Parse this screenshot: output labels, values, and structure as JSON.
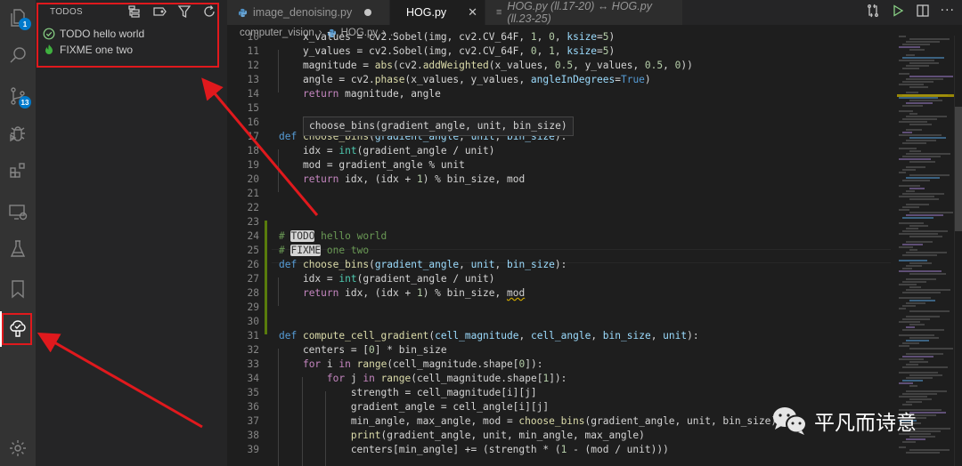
{
  "activity_bar": {
    "explorer_badge": "1",
    "source_control_badge": "13",
    "items": [
      "explorer",
      "search",
      "source-control",
      "run-debug",
      "extensions",
      "remote-explorer",
      "testing",
      "bookmarks",
      "todo-tree",
      "settings"
    ]
  },
  "sidebar": {
    "title": "TODOS",
    "actions": [
      "tree-view",
      "tag",
      "filter",
      "refresh"
    ],
    "items": [
      {
        "label": "TODO hello world",
        "icon": "check-circle-icon",
        "color": "#89d185"
      },
      {
        "label": "FIXME one two",
        "icon": "flame-icon",
        "color": "#3fb03f"
      }
    ]
  },
  "tabs": [
    {
      "label": "image_denoising.py",
      "modified": true,
      "active": false
    },
    {
      "label": "HOG.py",
      "active": true
    },
    {
      "label": "HOG.py (ll.17-20) ↔ HOG.py (ll.23-25)",
      "active": false
    }
  ],
  "breadcrumb": {
    "folder": "computer_vision",
    "file": "HOG.py",
    "more": "..."
  },
  "hover_tooltip": "choose_bins(gradient_angle, unit, bin_size)",
  "code_lines": [
    {
      "n": "10",
      "html": "    x_values = cv2.Sobel(img, cv2.CV_64F, <span class='num'>1</span>, <span class='num'>0</span>, <span class='param'>ksize</span>=<span class='num'>5</span>)"
    },
    {
      "n": "11",
      "html": "    y_values = cv2.Sobel(img, cv2.CV_64F, <span class='num'>0</span>, <span class='num'>1</span>, <span class='param'>ksize</span>=<span class='num'>5</span>)"
    },
    {
      "n": "12",
      "html": "    magnitude = <span class='fn'>abs</span>(cv2.<span class='fn'>addWeighted</span>(x_values, <span class='num'>0.5</span>, y_values, <span class='num'>0.5</span>, <span class='num'>0</span>))"
    },
    {
      "n": "13",
      "html": "    angle = cv2.<span class='fn'>phase</span>(x_values, y_values, <span class='param'>angleInDegrees</span>=<span class='kw'>True</span>)"
    },
    {
      "n": "14",
      "html": "    <span class='ctl'>return</span> magnitude, angle"
    },
    {
      "n": "15",
      "html": ""
    },
    {
      "n": "16",
      "html": ""
    },
    {
      "n": "17",
      "html": "<span class='kw'>def</span> <span class='fn'>choose_bins</span>(<span class='param'>gradient_angle</span>, <span class='param'>unit</span>, <span class='param'>bin_size</span>):"
    },
    {
      "n": "18",
      "html": "    idx = <span class='bi'>int</span>(gradient_angle / unit)"
    },
    {
      "n": "19",
      "html": "    mod = gradient_angle % unit"
    },
    {
      "n": "20",
      "html": "    <span class='ctl'>return</span> idx, (idx + <span class='num'>1</span>) % bin_size, mod"
    },
    {
      "n": "21",
      "html": ""
    },
    {
      "n": "22",
      "html": ""
    },
    {
      "n": "23",
      "html": ""
    },
    {
      "n": "24",
      "html": "<span class='cm'># <span class='tag'>TODO</span> hello world</span>"
    },
    {
      "n": "25",
      "html": "<span class='cm'># <span class='tag'>FIXME</span> one two</span>"
    },
    {
      "n": "26",
      "html": "<span class='kw'>def</span> <span class='fn'>choose_bins</span>(<span class='param'>gradient_angle</span>, <span class='param'>unit</span>, <span class='param'>bin_size</span>):"
    },
    {
      "n": "27",
      "html": "    idx = <span class='bi'>int</span>(gradient_angle / unit)"
    },
    {
      "n": "28",
      "html": "    <span class='ctl'>return</span> idx, (idx + <span class='num'>1</span>) % bin_size, <span class='warn'>mod</span>"
    },
    {
      "n": "29",
      "html": ""
    },
    {
      "n": "30",
      "html": ""
    },
    {
      "n": "31",
      "html": "<span class='kw'>def</span> <span class='fn'>compute_cell_gradient</span>(<span class='param'>cell_magnitude</span>, <span class='param'>cell_angle</span>, <span class='param'>bin_size</span>, <span class='param'>unit</span>):"
    },
    {
      "n": "32",
      "html": "    centers = [<span class='num'>0</span>] * bin_size"
    },
    {
      "n": "33",
      "html": "    <span class='ctl'>for</span> i <span class='ctl'>in</span> <span class='fn'>range</span>(cell_magnitude.shape[<span class='num'>0</span>]):"
    },
    {
      "n": "34",
      "html": "        <span class='ctl'>for</span> j <span class='ctl'>in</span> <span class='fn'>range</span>(cell_magnitude.shape[<span class='num'>1</span>]):"
    },
    {
      "n": "35",
      "html": "            strength = cell_magnitude[i][j]"
    },
    {
      "n": "36",
      "html": "            gradient_angle = cell_angle[i][j]"
    },
    {
      "n": "37",
      "html": "            min_angle, max_angle, mod = <span class='fn'>choose_bins</span>(gradient_angle, unit, bin_size)"
    },
    {
      "n": "38",
      "html": "            <span class='fn'>print</span>(gradient_angle, unit, min_angle, max_angle)"
    },
    {
      "n": "39",
      "html": "            centers[min_angle] += (strength * (<span class='num'>1</span> - (mod / unit)))"
    }
  ],
  "watermark": {
    "text": "平凡而诗意"
  },
  "colors": {
    "annotation_red": "#e0191d",
    "badge_blue": "#007acc",
    "gutter_modified": "#587c0c"
  }
}
